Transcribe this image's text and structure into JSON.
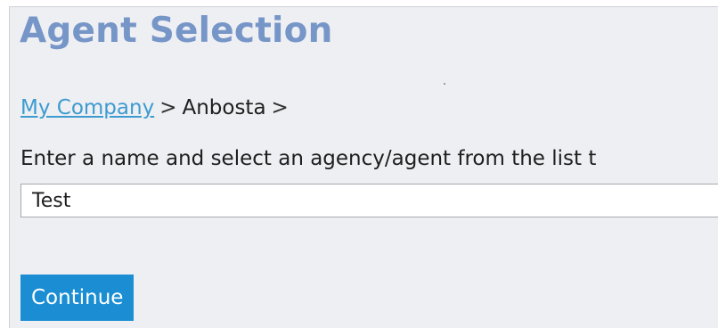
{
  "header": {
    "title": "Agent Selection"
  },
  "breadcrumb": {
    "link_label": "My Company",
    "separator": ">",
    "current": "Anbosta",
    "trailing_separator": ">"
  },
  "form": {
    "instruction": "Enter a name and select an agency/agent from the list",
    "instruction_overflow": " t",
    "name_value": "Test",
    "continue_label": "Continue"
  },
  "colors": {
    "title": "#7796c8",
    "link": "#3d9bd0",
    "button_bg": "#1b8ed3",
    "panel_bg": "#eeeff3"
  }
}
